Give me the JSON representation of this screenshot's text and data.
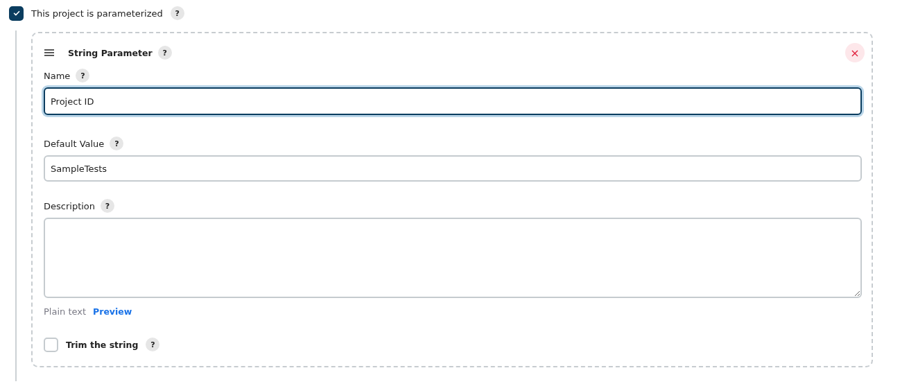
{
  "parameterized": {
    "label": "This project is parameterized",
    "checked": true,
    "help": "?"
  },
  "parameter": {
    "title": "String Parameter",
    "help": "?",
    "close": "×",
    "fields": [
      {
        "kind": "input",
        "label": "Name",
        "help": "?",
        "value": "Project ID",
        "focused": true
      },
      {
        "kind": "input",
        "label": "Default Value",
        "help": "?",
        "value": "SampleTests",
        "focused": false
      },
      {
        "kind": "textarea",
        "label": "Description",
        "help": "?",
        "focused": false
      }
    ],
    "format": {
      "mode": "Plain text",
      "link": "Preview"
    },
    "trim": {
      "label": "Trim the string",
      "checked": false,
      "help": "?"
    }
  }
}
